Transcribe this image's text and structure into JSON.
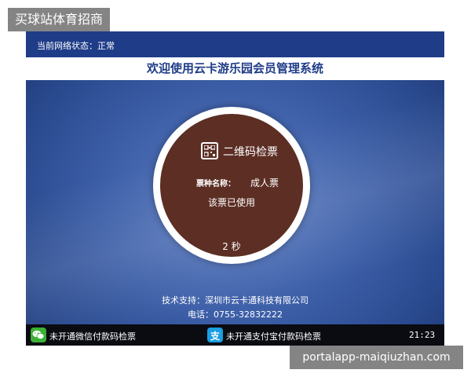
{
  "watermark": {
    "top_label": "买球站体育招商",
    "bottom_label": "portalapp-maiqiuzhan.com"
  },
  "kiosk": {
    "status_text": "当前网络状态：正常",
    "title": "欢迎使用云卡游乐园会员管理系统",
    "panel": {
      "icon": "qr-code-icon",
      "heading": "二维码检票",
      "ticket_type_label": "票种名称：",
      "ticket_type_value": "成人票",
      "ticket_status": "该票已使用",
      "countdown": "2 秒"
    },
    "footer": {
      "support": "技术支持：深圳市云卡通科技有限公司",
      "phone": "电话：0755-32832222"
    },
    "bottom_bar": {
      "wechat_icon": "wechat-icon",
      "wechat_text": "未开通微信付款码检票",
      "alipay_icon": "alipay-icon",
      "alipay_glyph": "支",
      "alipay_text": "未开通支付宝付款码检票",
      "clock": "21:23"
    },
    "colors": {
      "header_blue": "#1f3c88",
      "panel_brown": "#5c2e24",
      "wechat_green": "#3cb035",
      "alipay_blue": "#1a9ee0"
    }
  }
}
